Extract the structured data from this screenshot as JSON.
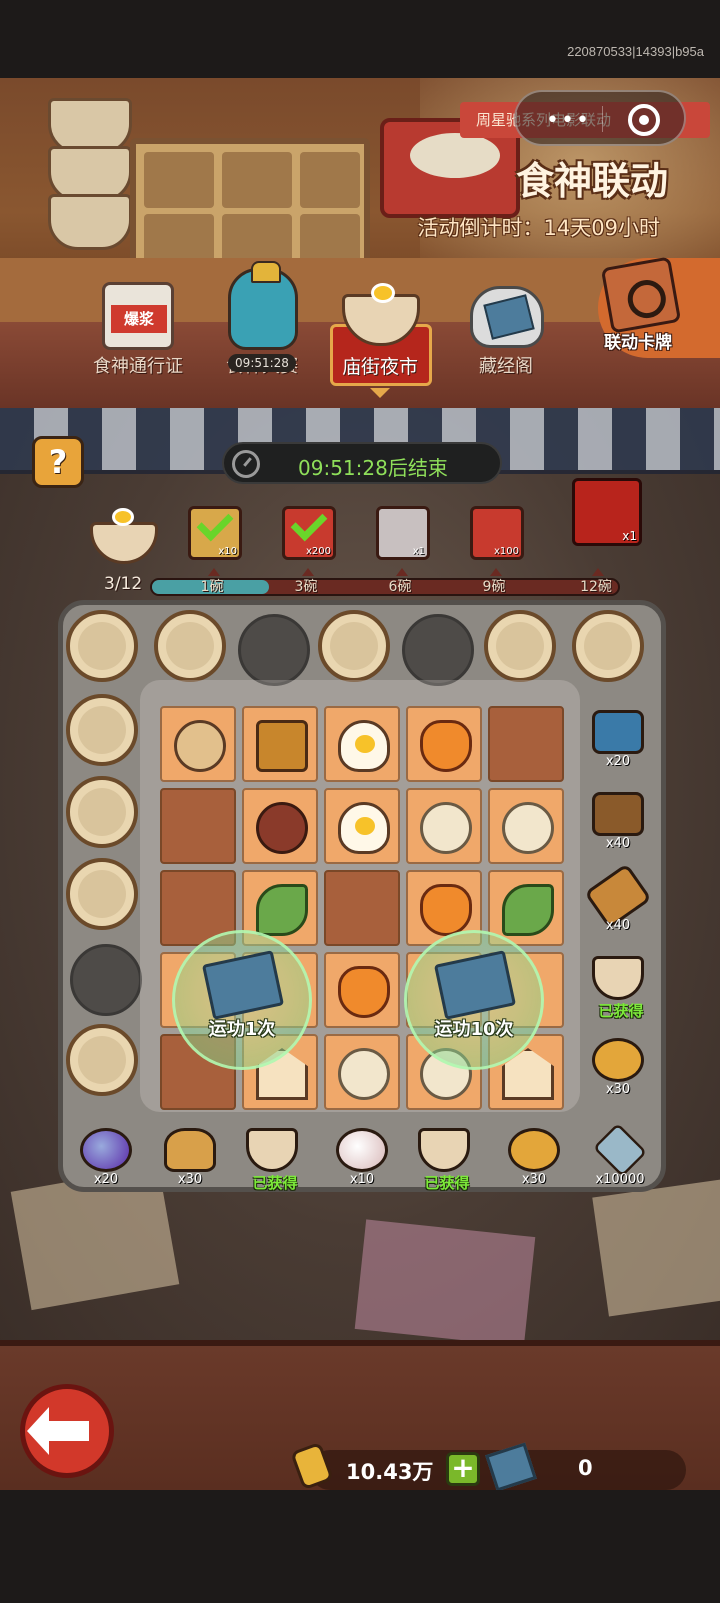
{
  "build_id": "220870533|14393|b95a",
  "header": {
    "ribbon_text": "周星驰系列电影联动",
    "menu_dots": "•••",
    "event_title": "食神联动",
    "countdown": "活动倒计时：14天09小时"
  },
  "tabs": [
    {
      "label": "食神通行证",
      "icon": "can-icon"
    },
    {
      "label": "食神大赛",
      "icon": "jar-icon",
      "timer": "09:51:28"
    },
    {
      "label": "庙街夜市",
      "icon": "bowl-icon",
      "active": true
    },
    {
      "label": "藏经阁",
      "icon": "book-sack-icon"
    }
  ],
  "card_tab": {
    "label": "联动卡牌"
  },
  "help_label": "?",
  "ends_timer": "09:51:28后结束",
  "progress": {
    "text": "3/12",
    "current": 3,
    "total": 12,
    "milestones": [
      {
        "label": "1碗",
        "qty": "x10",
        "claimed": true
      },
      {
        "label": "3碗",
        "qty": "x200",
        "claimed": true
      },
      {
        "label": "6碗",
        "qty": "x1",
        "claimed": false
      },
      {
        "label": "9碗",
        "qty": "x100",
        "claimed": false
      },
      {
        "label": "12碗",
        "qty": "x1",
        "claimed": false
      }
    ]
  },
  "bubbles": [
    {
      "label": "运功1次"
    },
    {
      "label": "运功10次"
    }
  ],
  "right_rewards": [
    {
      "icon": "blue-chest-icon",
      "label": "x20"
    },
    {
      "icon": "brown-chest-icon",
      "label": "x40"
    },
    {
      "icon": "key-icon",
      "label": "x40"
    },
    {
      "icon": "bowl-icon",
      "label": "已获得"
    },
    {
      "icon": "coin-icon",
      "label": "x30"
    }
  ],
  "bottom_rewards": [
    {
      "icon": "orb-icon",
      "label": "x20"
    },
    {
      "icon": "bag-icon",
      "label": "x30"
    },
    {
      "icon": "bowl-icon",
      "label": "已获得"
    },
    {
      "icon": "pearl-icon",
      "label": "x10"
    },
    {
      "icon": "bowl-icon",
      "label": "已获得"
    },
    {
      "icon": "coin-icon",
      "label": "x30"
    },
    {
      "icon": "crystal-icon",
      "label": "x10000"
    }
  ],
  "resources": {
    "gold": "10.43万",
    "books": "0"
  },
  "colors": {
    "accent_red": "#b5261c",
    "timer_green": "#8fdf5a",
    "obtained_green": "#7dea3a",
    "progress_teal": "#4aa0a4"
  }
}
